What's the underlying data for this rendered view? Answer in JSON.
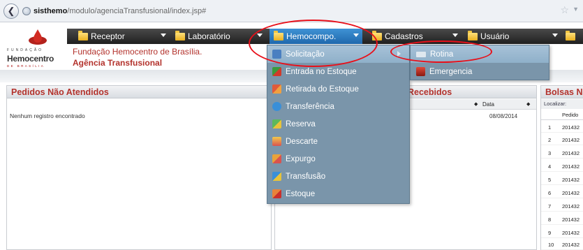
{
  "browser": {
    "url_host": "sisthemo",
    "url_path": "/modulo/agenciaTransfusional/index.jsp#",
    "back_icon": "back-arrow-icon",
    "star_icon": "bookmark-star-icon"
  },
  "logo": {
    "small_text": "FUNDAÇÃO",
    "title": "Hemocentro",
    "sub_text": "DE BRASÍLIA"
  },
  "header": {
    "org_name": "Fundação Hemocentro de Brasília.",
    "unit_name": "Agência Transfusional"
  },
  "menu": {
    "items": [
      {
        "label": "Receptor"
      },
      {
        "label": "Laboratório"
      },
      {
        "label": "Hemocompo."
      },
      {
        "label": "Cadastros"
      },
      {
        "label": "Usuário"
      },
      {
        "label": ""
      }
    ]
  },
  "dropdown": {
    "items": [
      {
        "label": "Solicitação",
        "icon": "request-form-icon"
      },
      {
        "label": "Entrada no Estoque",
        "icon": "stock-in-icon"
      },
      {
        "label": "Retirada do Estoque",
        "icon": "stock-out-icon"
      },
      {
        "label": "Transferência",
        "icon": "transfer-icon"
      },
      {
        "label": "Reserva",
        "icon": "reserve-icon"
      },
      {
        "label": "Descarte",
        "icon": "discard-icon"
      },
      {
        "label": "Expurgo",
        "icon": "purge-icon"
      },
      {
        "label": "Transfusão",
        "icon": "transfusion-icon"
      },
      {
        "label": "Estoque",
        "icon": "stock-icon"
      }
    ]
  },
  "submenu": {
    "items": [
      {
        "label": "Rotina",
        "icon": "routine-icon"
      },
      {
        "label": "Emergencia",
        "icon": "emergency-icon"
      }
    ]
  },
  "panels": {
    "left": {
      "title": "Pedidos Não Atendidos",
      "empty_message": "Nenhum registro encontrado"
    },
    "middle": {
      "title": "Recebidos",
      "col_date": "Data",
      "date_value": "08/08/2014"
    },
    "right": {
      "title": "Bolsas N",
      "search_label": "Localizar:",
      "col_pedido": "Pedido",
      "rows": [
        {
          "idx": "1",
          "val": "201432"
        },
        {
          "idx": "2",
          "val": "201432"
        },
        {
          "idx": "3",
          "val": "201432"
        },
        {
          "idx": "4",
          "val": "201432"
        },
        {
          "idx": "5",
          "val": "201432"
        },
        {
          "idx": "6",
          "val": "201432"
        },
        {
          "idx": "7",
          "val": "201432"
        },
        {
          "idx": "8",
          "val": "201432"
        },
        {
          "idx": "9",
          "val": "201432"
        },
        {
          "idx": "10",
          "val": "201432"
        }
      ]
    }
  },
  "colors": {
    "accent_red": "#b3322c",
    "menu_active": "#1f68ad",
    "dropdown_bg": "#7a95aa",
    "annotation": "#e8101a"
  }
}
